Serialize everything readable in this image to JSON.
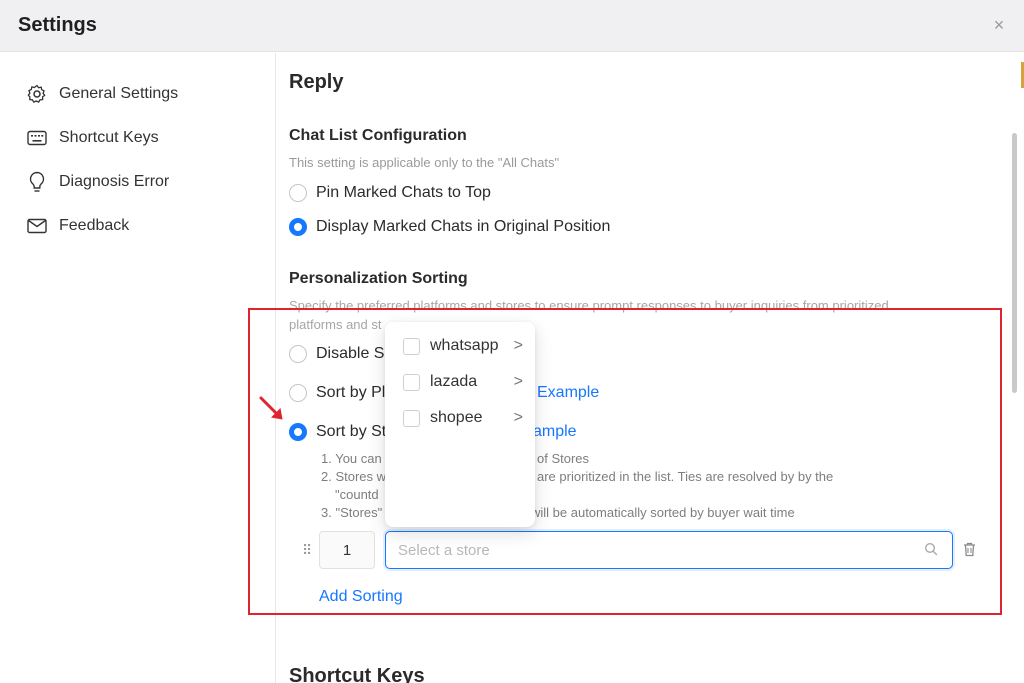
{
  "window": {
    "title": "Settings",
    "close_glyph": "×"
  },
  "sidebar": {
    "items": [
      {
        "label": "General Settings",
        "icon": "gear-icon"
      },
      {
        "label": "Shortcut Keys",
        "icon": "keyboard-icon"
      },
      {
        "label": "Diagnosis Error",
        "icon": "lightbulb-icon"
      },
      {
        "label": "Feedback",
        "icon": "mail-icon"
      }
    ]
  },
  "main": {
    "section_title": "Reply",
    "chat_list": {
      "title": "Chat List Configuration",
      "hint": "This setting is applicable only to the \"All Chats\"",
      "options": [
        {
          "label": "Pin Marked Chats to Top",
          "selected": false
        },
        {
          "label": "Display Marked Chats in Original Position",
          "selected": true
        }
      ]
    },
    "personalization": {
      "title": "Personalization Sorting",
      "hint_line1": "Specify the preferred platforms and stores to ensure prompt responses to buyer inquiries from prioritized",
      "hint_line2": "platforms and st",
      "options": [
        {
          "label": "Disable So",
          "link": "",
          "selected": false
        },
        {
          "label": "Sort by Pl",
          "link": "Example",
          "selected": false
        },
        {
          "label": "Sort by St",
          "link": "ample",
          "selected": true
        }
      ],
      "notes": [
        {
          "left": "1. You can",
          "right": "of Stores"
        },
        {
          "left": "2. Stores w",
          "right": "are prioritized in the list. Ties are resolved by by the"
        },
        {
          "left": "\"countd",
          "right": ""
        },
        {
          "left": "3. \"Stores\"",
          "right": "will be automatically sorted by buyer wait time"
        }
      ],
      "sorting_row": {
        "order": "1",
        "store_placeholder": "Select a store"
      },
      "add_sorting_label": "Add Sorting"
    },
    "next_section_title": "Shortcut Keys"
  },
  "dropdown": {
    "items": [
      {
        "label": "whatsapp",
        "checked": false
      },
      {
        "label": "lazada",
        "checked": false
      },
      {
        "label": "shopee",
        "checked": false
      }
    ],
    "chevron": ">"
  },
  "colors": {
    "accent": "#1677ff",
    "highlight": "#e0242f"
  }
}
